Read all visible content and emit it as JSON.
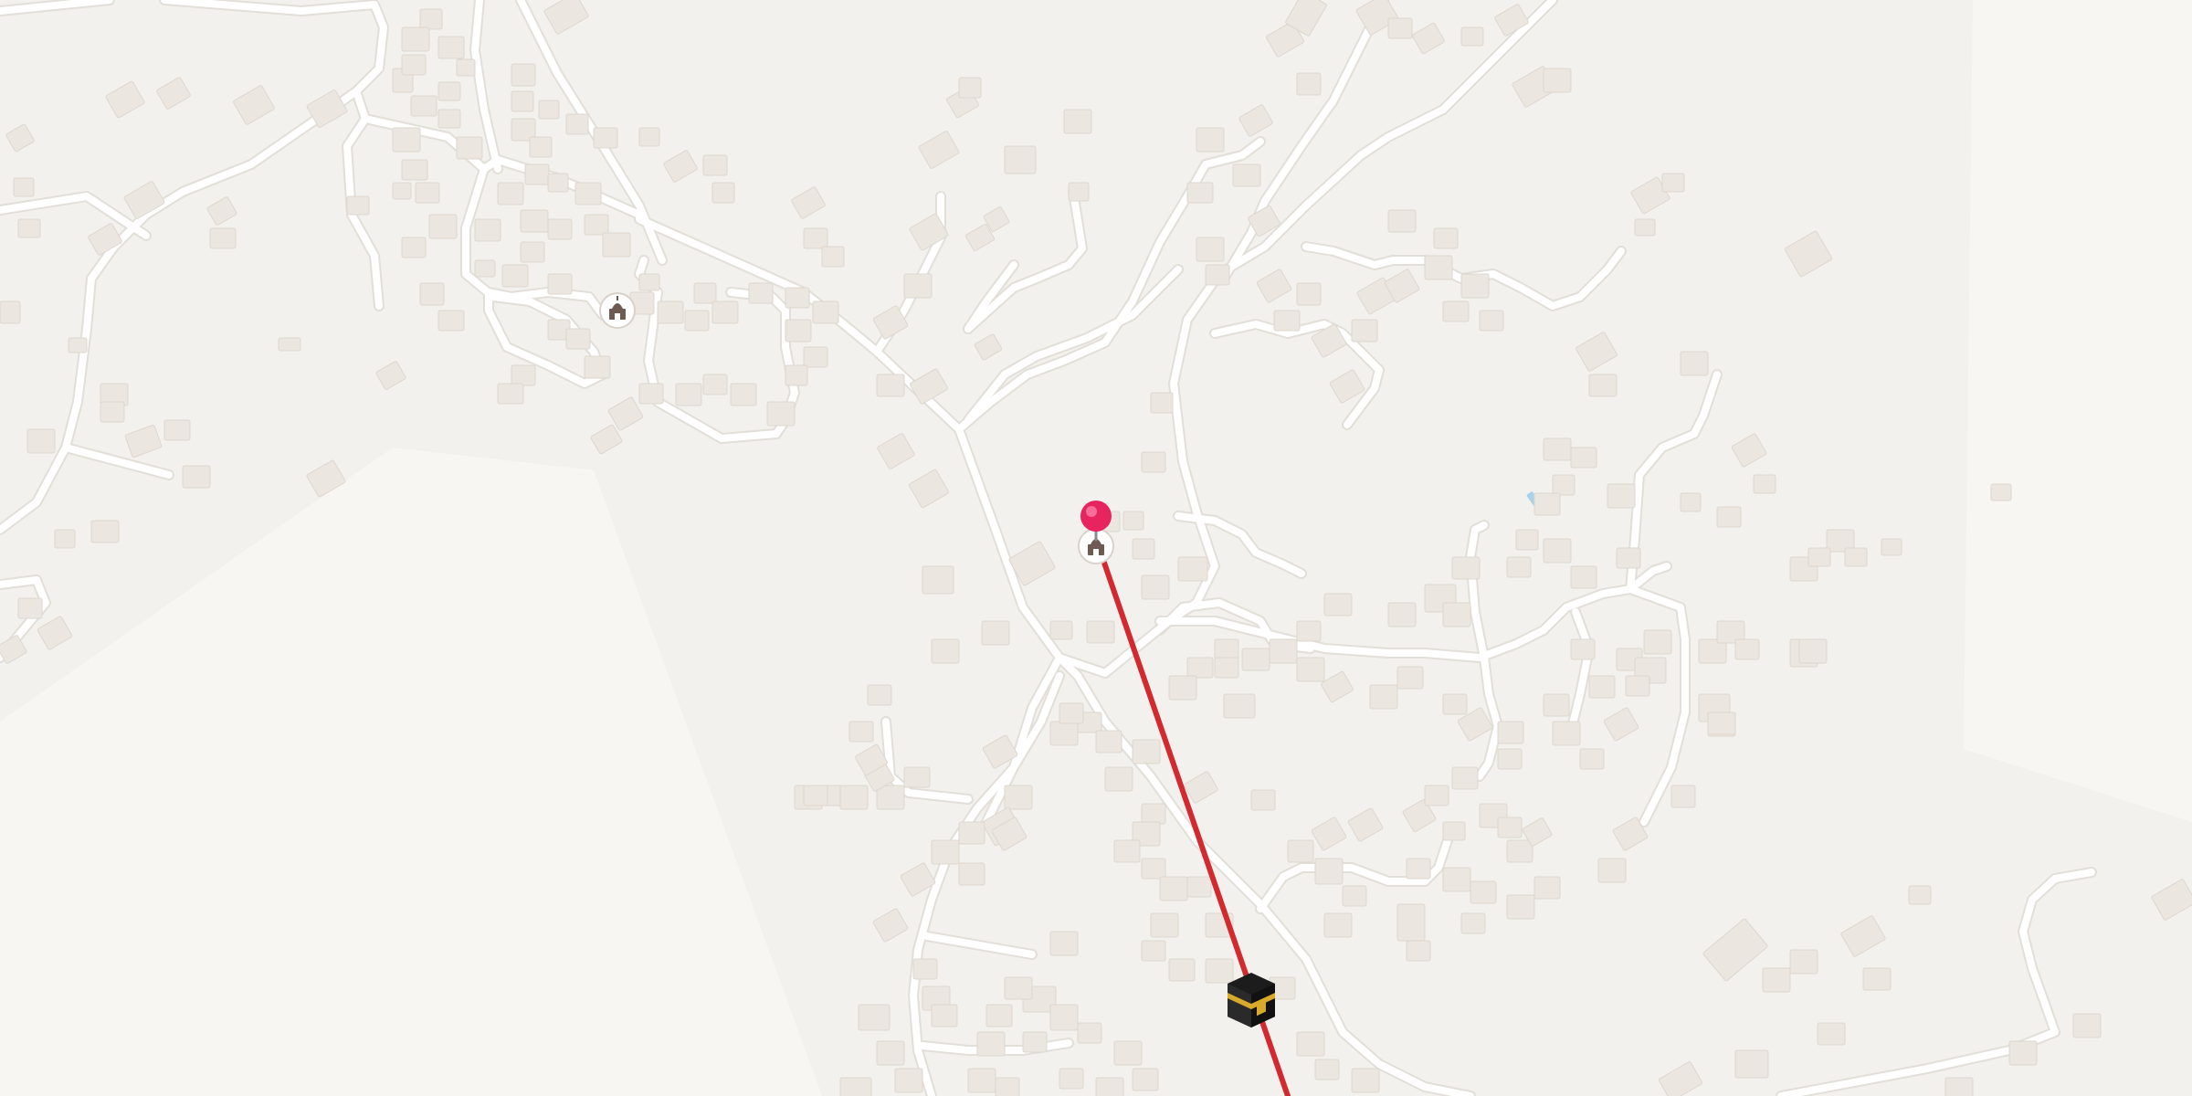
{
  "map": {
    "colors": {
      "background": "#f3f1ee",
      "open_area": "#f7f5f2",
      "road": "#ffffff",
      "road_casing": "#e2ded8",
      "building": "#ebe6df",
      "building_edge": "#ddd7cf",
      "qibla_line": "#d32a30",
      "pin": "#e8245f",
      "poi_icon": "#6e5a52",
      "water": "#a9d2ea"
    },
    "markers": {
      "location_pin": {
        "name": "location-pin"
      },
      "mosque_center": {
        "icon": "mosque-icon"
      },
      "mosque_west": {
        "icon": "mosque-icon"
      },
      "kaaba": {
        "icon": "kaaba-icon"
      }
    },
    "qibla_direction_line": {
      "kind": "line",
      "color": "#d32a30"
    }
  }
}
